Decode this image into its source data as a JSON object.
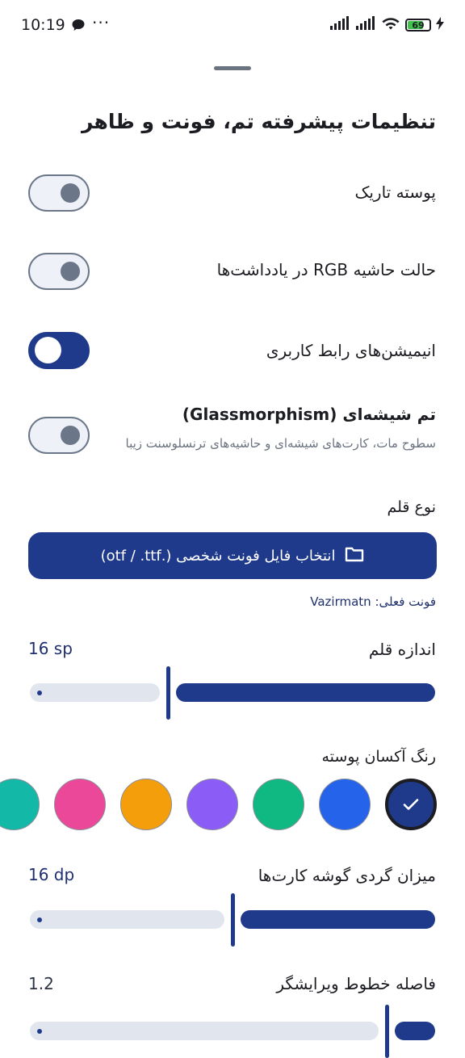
{
  "status_bar": {
    "time": "10:19",
    "more": "···",
    "battery": "69"
  },
  "sheet": {
    "title": "تنظیمات پیشرفته تم، فونت و ظاهر"
  },
  "toggles": [
    {
      "label": "پوسته تاریک",
      "on": false
    },
    {
      "label": "حالت حاشیه RGB در یادداشت‌ها",
      "on": false
    },
    {
      "label": "انیمیشن‌های رابط کاربری",
      "on": true
    },
    {
      "label": "تم شیشه‌ای (Glassmorphism)",
      "subtitle": "سطوح مات، کارت‌های شیشه‌ای و حاشیه‌های ترنسلوسنت زیبا",
      "on": false
    }
  ],
  "font": {
    "section_label": "نوع قلم",
    "pick_button": "انتخاب فایل فونت شخصی (.otf / .ttf)",
    "current_font": "فونت فعلی: Vazirmatn"
  },
  "font_size": {
    "label": "اندازه قلم",
    "value_text": "16 sp",
    "fraction": 0.66
  },
  "accent": {
    "label": "رنگ آکسان پوسته",
    "colors": [
      "#1f3a8a",
      "#2563eb",
      "#10b981",
      "#8b5cf6",
      "#f59e0b",
      "#ec4899",
      "#14b8a6"
    ],
    "selected_index": 0
  },
  "corner_radius": {
    "label": "میزان گردی گوشه کارت‌ها",
    "value_text": "16 dp",
    "fraction": 0.5
  },
  "line_spacing": {
    "label": "فاصله خطوط ویرایشگر",
    "value_text": "1.2",
    "fraction": 0.12
  }
}
